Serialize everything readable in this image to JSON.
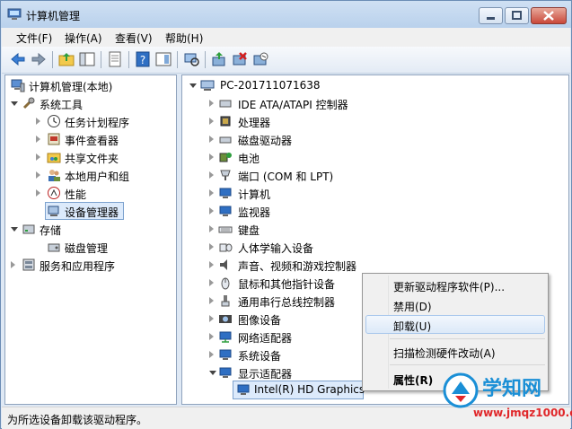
{
  "window": {
    "title": "计算机管理"
  },
  "menubar": {
    "items": [
      "文件(F)",
      "操作(A)",
      "查看(V)",
      "帮助(H)"
    ]
  },
  "left_tree": [
    {
      "label": "计算机管理(本地)",
      "icon": "computer-management-icon"
    },
    {
      "label": "系统工具",
      "icon": "tools-icon"
    },
    {
      "label": "任务计划程序",
      "icon": "clock-icon"
    },
    {
      "label": "事件查看器",
      "icon": "event-viewer-icon"
    },
    {
      "label": "共享文件夹",
      "icon": "shared-folder-icon"
    },
    {
      "label": "本地用户和组",
      "icon": "users-icon"
    },
    {
      "label": "性能",
      "icon": "performance-icon"
    },
    {
      "label": "设备管理器",
      "icon": "device-manager-icon"
    },
    {
      "label": "存储",
      "icon": "storage-icon"
    },
    {
      "label": "磁盘管理",
      "icon": "disk-management-icon"
    },
    {
      "label": "服务和应用程序",
      "icon": "services-icon"
    }
  ],
  "right_tree": {
    "root": "PC-201711071638",
    "items": [
      "IDE ATA/ATAPI 控制器",
      "处理器",
      "磁盘驱动器",
      "电池",
      "端口 (COM 和 LPT)",
      "计算机",
      "监视器",
      "键盘",
      "人体学输入设备",
      "声音、视频和游戏控制器",
      "鼠标和其他指针设备",
      "通用串行总线控制器",
      "图像设备",
      "网络适配器",
      "系统设备",
      "显示适配器"
    ],
    "selected_child": "Intel(R) HD Graphics"
  },
  "context_menu": {
    "items": [
      "更新驱动程序软件(P)...",
      "禁用(D)",
      "卸载(U)",
      "扫描检测硬件改动(A)",
      "属性(R)"
    ],
    "hovered_index": 2
  },
  "statusbar": {
    "text": "为所选设备卸载该驱动程序。"
  },
  "watermark": {
    "text": "学知网",
    "url": "www.jmqz1000.com"
  }
}
